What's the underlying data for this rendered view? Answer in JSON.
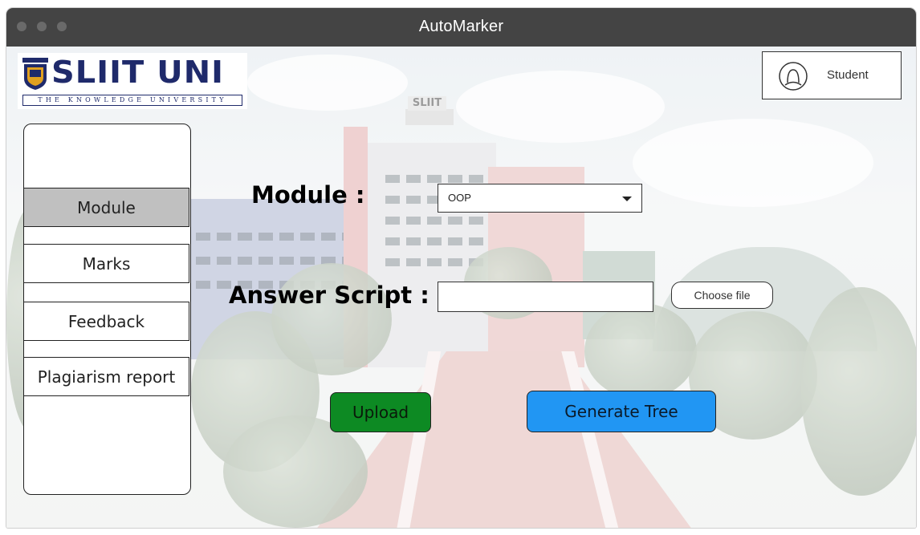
{
  "window": {
    "title": "AutoMarker"
  },
  "logo": {
    "main_text": "SLIIT UNI",
    "sub_text": "THE KNOWLEDGE UNIVERSITY",
    "brand_color": "#1f2a6b"
  },
  "header": {
    "user_label": "Student",
    "user_icon": "user-avatar-icon"
  },
  "sidebar": {
    "items": [
      {
        "label": "Module",
        "active": true
      },
      {
        "label": "Marks",
        "active": false
      },
      {
        "label": "Feedback",
        "active": false
      },
      {
        "label": "Plagiarism report",
        "active": false
      }
    ],
    "active_color": "#c0c0c0"
  },
  "form": {
    "module_label": "Module :",
    "module_selected": "OOP",
    "answer_label": "Answer Script :",
    "file_value": "",
    "choose_file_label": "Choose file"
  },
  "actions": {
    "upload_label": "Upload",
    "upload_color": "#0d8a23",
    "tree_label": "Generate Tree",
    "tree_color": "#2196f3"
  },
  "background": {
    "description_icon": "campus-building-image",
    "building_sign": "SLIIT"
  }
}
